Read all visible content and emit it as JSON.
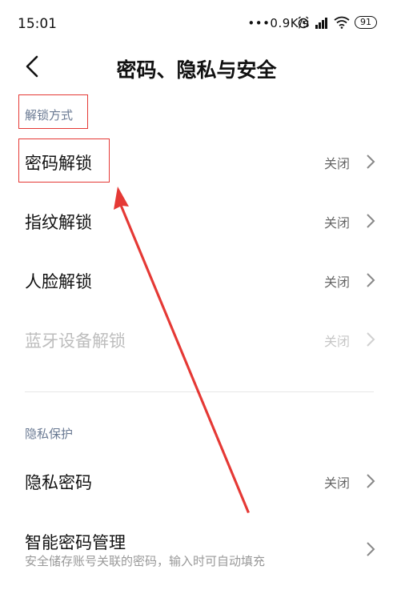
{
  "status_bar": {
    "time": "15:01",
    "network_speed": "•••0.9K/s",
    "battery_level": "91"
  },
  "header": {
    "title": "密码、隐私与安全"
  },
  "section_unlock": {
    "label": "解锁方式",
    "items": [
      {
        "label": "密码解锁",
        "value": "关闭"
      },
      {
        "label": "指纹解锁",
        "value": "关闭"
      },
      {
        "label": "人脸解锁",
        "value": "关闭"
      },
      {
        "label": "蓝牙设备解锁",
        "value": "关闭",
        "disabled": true
      }
    ]
  },
  "section_privacy": {
    "label": "隐私保护",
    "items": [
      {
        "label": "隐私密码",
        "value": "关闭"
      },
      {
        "label": "智能密码管理",
        "subtitle": "安全储存账号关联的密码，输入时可自动填充"
      }
    ]
  },
  "colors": {
    "annotation": "#e53935",
    "section_label": "#6a7a93"
  }
}
